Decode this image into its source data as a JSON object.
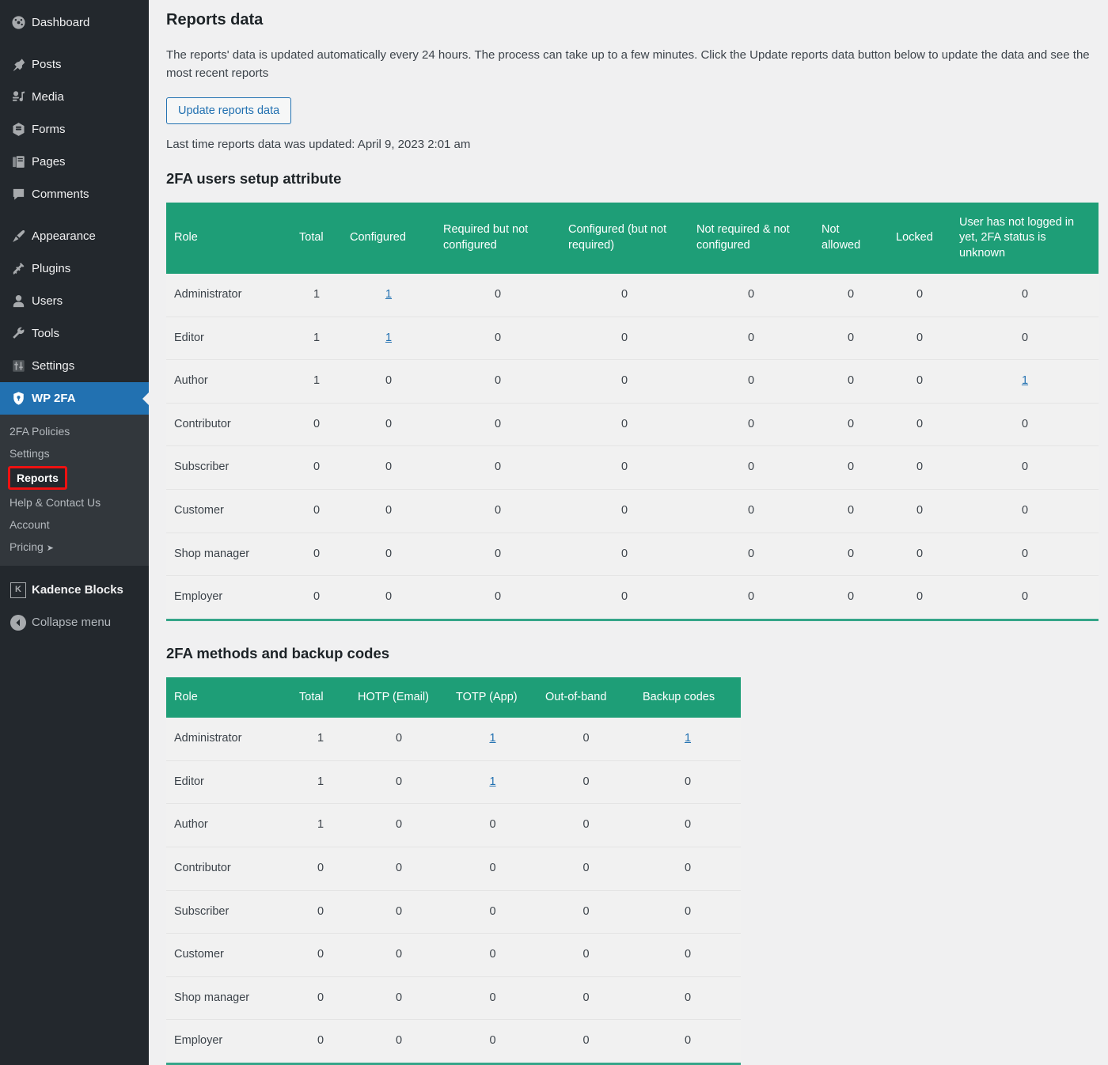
{
  "sidebar": {
    "items": [
      {
        "label": "Dashboard",
        "icon": "dashboard-icon"
      },
      {
        "label": "Posts",
        "icon": "pin-icon"
      },
      {
        "label": "Media",
        "icon": "media-icon"
      },
      {
        "label": "Forms",
        "icon": "forms-icon"
      },
      {
        "label": "Pages",
        "icon": "pages-icon"
      },
      {
        "label": "Comments",
        "icon": "comments-icon"
      },
      {
        "label": "Appearance",
        "icon": "brush-icon"
      },
      {
        "label": "Plugins",
        "icon": "plug-icon"
      },
      {
        "label": "Users",
        "icon": "user-icon"
      },
      {
        "label": "Tools",
        "icon": "wrench-icon"
      },
      {
        "label": "Settings",
        "icon": "sliders-icon"
      },
      {
        "label": "WP 2FA",
        "icon": "shield-lock-icon"
      }
    ],
    "submenu": [
      {
        "label": "2FA Policies"
      },
      {
        "label": "Settings"
      },
      {
        "label": "Reports"
      },
      {
        "label": "Help & Contact Us"
      },
      {
        "label": "Account"
      },
      {
        "label": "Pricing"
      }
    ],
    "pricing_arrow": "➤",
    "lower": [
      {
        "label": "Kadence Blocks",
        "icon": "kadence-icon",
        "glyph": "K"
      },
      {
        "label": "Collapse menu",
        "icon": "collapse-left-icon"
      }
    ],
    "colors": {
      "menu_bg": "#23282d",
      "submenu_bg": "#32373c",
      "active_bg": "#2271b1",
      "annotation": "#ee1111"
    }
  },
  "main": {
    "page_title": "Reports data",
    "intro": "The reports' data is updated automatically every 24 hours. The process can take up to a few minutes. Click the Update reports data button below to update the data and see the most recent reports",
    "update_button": "Update reports data",
    "last_updated": "Last time reports data was updated: April 9, 2023 2:01 am",
    "accent_color": "#1e9e77",
    "link_color": "#2271b1",
    "section_1": {
      "title": "2FA users setup attribute",
      "columns": [
        "Role",
        "Total",
        "Configured",
        "Required but not configured",
        "Configured (but not required)",
        "Not required & not configured",
        "Not allowed",
        "Locked",
        "User has not logged in yet, 2FA status is unknown"
      ],
      "rows": [
        {
          "role": "Administrator",
          "cells": [
            {
              "v": "1"
            },
            {
              "v": "1",
              "link": true
            },
            {
              "v": "0"
            },
            {
              "v": "0"
            },
            {
              "v": "0"
            },
            {
              "v": "0"
            },
            {
              "v": "0"
            },
            {
              "v": "0"
            }
          ]
        },
        {
          "role": "Editor",
          "cells": [
            {
              "v": "1"
            },
            {
              "v": "1",
              "link": true
            },
            {
              "v": "0"
            },
            {
              "v": "0"
            },
            {
              "v": "0"
            },
            {
              "v": "0"
            },
            {
              "v": "0"
            },
            {
              "v": "0"
            }
          ]
        },
        {
          "role": "Author",
          "cells": [
            {
              "v": "1"
            },
            {
              "v": "0"
            },
            {
              "v": "0"
            },
            {
              "v": "0"
            },
            {
              "v": "0"
            },
            {
              "v": "0"
            },
            {
              "v": "0"
            },
            {
              "v": "1",
              "link": true
            }
          ]
        },
        {
          "role": "Contributor",
          "cells": [
            {
              "v": "0"
            },
            {
              "v": "0"
            },
            {
              "v": "0"
            },
            {
              "v": "0"
            },
            {
              "v": "0"
            },
            {
              "v": "0"
            },
            {
              "v": "0"
            },
            {
              "v": "0"
            }
          ]
        },
        {
          "role": "Subscriber",
          "cells": [
            {
              "v": "0"
            },
            {
              "v": "0"
            },
            {
              "v": "0"
            },
            {
              "v": "0"
            },
            {
              "v": "0"
            },
            {
              "v": "0"
            },
            {
              "v": "0"
            },
            {
              "v": "0"
            }
          ]
        },
        {
          "role": "Customer",
          "cells": [
            {
              "v": "0"
            },
            {
              "v": "0"
            },
            {
              "v": "0"
            },
            {
              "v": "0"
            },
            {
              "v": "0"
            },
            {
              "v": "0"
            },
            {
              "v": "0"
            },
            {
              "v": "0"
            }
          ]
        },
        {
          "role": "Shop manager",
          "cells": [
            {
              "v": "0"
            },
            {
              "v": "0"
            },
            {
              "v": "0"
            },
            {
              "v": "0"
            },
            {
              "v": "0"
            },
            {
              "v": "0"
            },
            {
              "v": "0"
            },
            {
              "v": "0"
            }
          ]
        },
        {
          "role": "Employer",
          "cells": [
            {
              "v": "0"
            },
            {
              "v": "0"
            },
            {
              "v": "0"
            },
            {
              "v": "0"
            },
            {
              "v": "0"
            },
            {
              "v": "0"
            },
            {
              "v": "0"
            },
            {
              "v": "0"
            }
          ]
        }
      ]
    },
    "section_2": {
      "title": "2FA methods and backup codes",
      "columns": [
        "Role",
        "Total",
        "HOTP (Email)",
        "TOTP (App)",
        "Out-of-band",
        "Backup codes"
      ],
      "rows": [
        {
          "role": "Administrator",
          "cells": [
            {
              "v": "1"
            },
            {
              "v": "0"
            },
            {
              "v": "1",
              "link": true
            },
            {
              "v": "0"
            },
            {
              "v": "1",
              "link": true
            }
          ]
        },
        {
          "role": "Editor",
          "cells": [
            {
              "v": "1"
            },
            {
              "v": "0"
            },
            {
              "v": "1",
              "link": true
            },
            {
              "v": "0"
            },
            {
              "v": "0"
            }
          ]
        },
        {
          "role": "Author",
          "cells": [
            {
              "v": "1"
            },
            {
              "v": "0"
            },
            {
              "v": "0"
            },
            {
              "v": "0"
            },
            {
              "v": "0"
            }
          ]
        },
        {
          "role": "Contributor",
          "cells": [
            {
              "v": "0"
            },
            {
              "v": "0"
            },
            {
              "v": "0"
            },
            {
              "v": "0"
            },
            {
              "v": "0"
            }
          ]
        },
        {
          "role": "Subscriber",
          "cells": [
            {
              "v": "0"
            },
            {
              "v": "0"
            },
            {
              "v": "0"
            },
            {
              "v": "0"
            },
            {
              "v": "0"
            }
          ]
        },
        {
          "role": "Customer",
          "cells": [
            {
              "v": "0"
            },
            {
              "v": "0"
            },
            {
              "v": "0"
            },
            {
              "v": "0"
            },
            {
              "v": "0"
            }
          ]
        },
        {
          "role": "Shop manager",
          "cells": [
            {
              "v": "0"
            },
            {
              "v": "0"
            },
            {
              "v": "0"
            },
            {
              "v": "0"
            },
            {
              "v": "0"
            }
          ]
        },
        {
          "role": "Employer",
          "cells": [
            {
              "v": "0"
            },
            {
              "v": "0"
            },
            {
              "v": "0"
            },
            {
              "v": "0"
            },
            {
              "v": "0"
            }
          ]
        }
      ]
    }
  }
}
